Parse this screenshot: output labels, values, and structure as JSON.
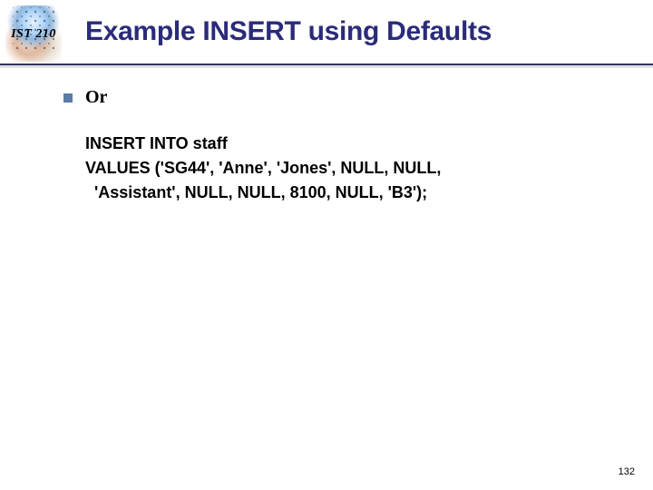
{
  "header": {
    "logo_label": "IST 210",
    "title": "Example INSERT using Defaults"
  },
  "body": {
    "bullet_label": "Or",
    "code_lines": [
      "INSERT INTO staff",
      "VALUES ('SG44', 'Anne', 'Jones', NULL, NULL,",
      "  'Assistant', NULL, NULL, 8100, NULL, 'B3');"
    ]
  },
  "footer": {
    "page_number": "132"
  }
}
